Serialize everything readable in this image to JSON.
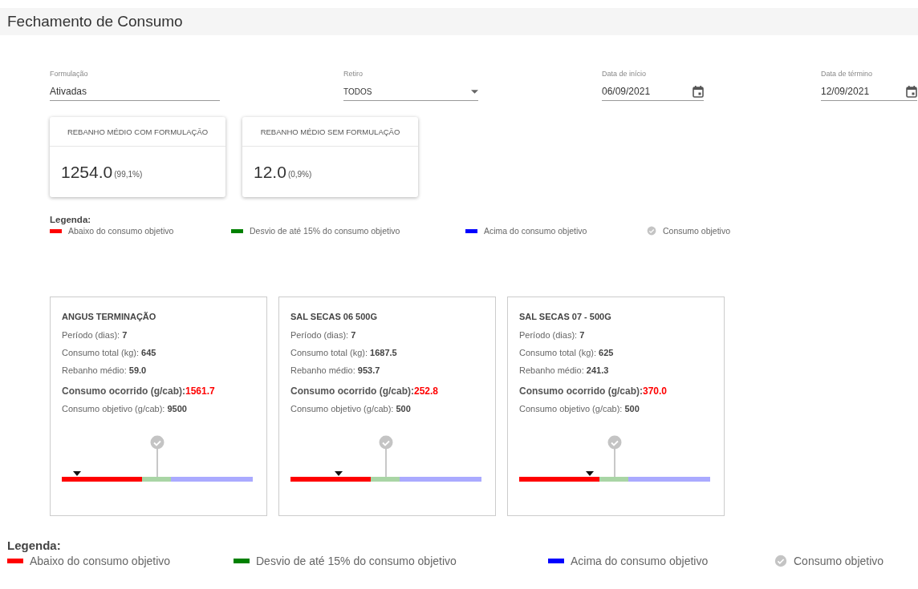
{
  "page_title": "Fechamento de Consumo",
  "filters": [
    {
      "kind": "text",
      "label": "Formulação",
      "value": "Ativadas"
    },
    {
      "kind": "select",
      "label": "Retiro",
      "value": "TODOS"
    },
    {
      "kind": "date",
      "label": "Data de início",
      "value": "06/09/2021"
    },
    {
      "kind": "date",
      "label": "Data de término",
      "value": "12/09/2021"
    }
  ],
  "summary_cards": [
    {
      "title": "REBANHO MÉDIO COM FORMULAÇÃO",
      "value": "1254.0",
      "share": "(99,1%)"
    },
    {
      "title": "REBANHO MÉDIO SEM FORMULAÇÃO",
      "value": "12.0",
      "share": "(0,9%)"
    }
  ],
  "legend_top": {
    "title": "Legenda:",
    "items": [
      {
        "kind": "bar",
        "color": "#ff0000",
        "label": "Abaixo do consumo objetivo"
      },
      {
        "kind": "bar",
        "color": "#008000",
        "label": "Desvio de até 15% do consumo objetivo"
      },
      {
        "kind": "bar",
        "color": "#0000ff",
        "label": "Acima do consumo objetivo"
      },
      {
        "kind": "check",
        "label": "Consumo objetivo"
      }
    ]
  },
  "formulations": [
    {
      "name": "ANGUS TERMINAÇÃO",
      "rows": [
        {
          "label": "Período (dias):",
          "value": "7"
        },
        {
          "label": "Consumo total (kg):",
          "value": "645"
        },
        {
          "label": "Rebanho médio:",
          "value": "59.0"
        }
      ],
      "actual_label": "Consumo ocorrido (g/cab):",
      "actual_value": "1561.7",
      "target_label": "Consumo objetivo (g/cab):",
      "target_value": "9500",
      "level": 0.08
    },
    {
      "name": "SAL SECAS 06 500G",
      "rows": [
        {
          "label": "Período (dias):",
          "value": "7"
        },
        {
          "label": "Consumo total (kg):",
          "value": "1687.5"
        },
        {
          "label": "Rebanho médio:",
          "value": "953.7"
        }
      ],
      "actual_label": "Consumo ocorrido (g/cab):",
      "actual_value": "252.8",
      "target_label": "Consumo objetivo (g/cab):",
      "target_value": "500",
      "level": 0.25
    },
    {
      "name": "SAL SECAS 07 - 500G",
      "rows": [
        {
          "label": "Período (dias):",
          "value": "7"
        },
        {
          "label": "Consumo total (kg):",
          "value": "625"
        },
        {
          "label": "Rebanho médio:",
          "value": "241.3"
        }
      ],
      "actual_label": "Consumo ocorrido (g/cab):",
      "actual_value": "370.0",
      "target_label": "Consumo objetivo (g/cab):",
      "target_value": "500",
      "level": 0.37
    }
  ],
  "legend_bottom": {
    "title": "Legenda:",
    "items": [
      {
        "kind": "bar",
        "color": "#ff0000",
        "label": "Abaixo do consumo objetivo"
      },
      {
        "kind": "bar",
        "color": "#008000",
        "label": "Desvio de até 15% do consumo objetivo"
      },
      {
        "kind": "bar",
        "color": "#0000ff",
        "label": "Acima do consumo objetivo"
      },
      {
        "kind": "check",
        "label": "Consumo objetivo"
      }
    ]
  }
}
